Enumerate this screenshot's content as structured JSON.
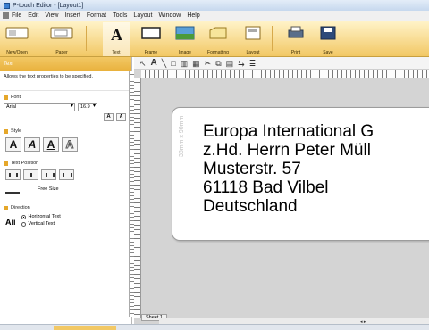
{
  "window": {
    "title": "P-touch Editor - [Layout1]"
  },
  "menu": {
    "items": [
      "File",
      "Edit",
      "View",
      "Insert",
      "Format",
      "Tools",
      "Layout",
      "Window",
      "Help"
    ]
  },
  "ribbon": {
    "buttons": [
      {
        "label": "New/Open",
        "icon": "new-open-icon"
      },
      {
        "label": "Paper",
        "icon": "paper-icon"
      },
      {
        "label": "Text",
        "icon": "text-icon"
      },
      {
        "label": "Frame",
        "icon": "frame-icon"
      },
      {
        "label": "Image",
        "icon": "image-icon"
      },
      {
        "label": "Formatting",
        "icon": "formatting-icon"
      },
      {
        "label": "Layout",
        "icon": "layout-icon"
      },
      {
        "label": "Print",
        "icon": "print-icon"
      },
      {
        "label": "Save",
        "icon": "save-icon"
      }
    ]
  },
  "sidebar": {
    "title": "Text",
    "description": "Allows the text properties to be specified.",
    "font_section": "Font",
    "font_value": "Arial",
    "size_value": "16.9",
    "style_section": "Style",
    "style_buttons": [
      "A",
      "A",
      "A",
      "A"
    ],
    "position_section": "Text Position",
    "free_size": "Free Size",
    "direction_section": "Direction",
    "direction_glyph": "Aii",
    "horizontal": "Horizontal Text",
    "vertical": "Vertical Text"
  },
  "canvas": {
    "label_dimension": "38mm x 90mm",
    "lines": [
      "Europa International G",
      "z.Hd. Herrn Peter Müll",
      "Musterstr. 57",
      "61118 Bad Vilbel",
      "Deutschland"
    ],
    "sheet_tab": "Sheet 1"
  },
  "colors": {
    "ribbon": "#f2c865",
    "accent": "#e5a72a",
    "canvas_bg": "#d4d4d4"
  }
}
